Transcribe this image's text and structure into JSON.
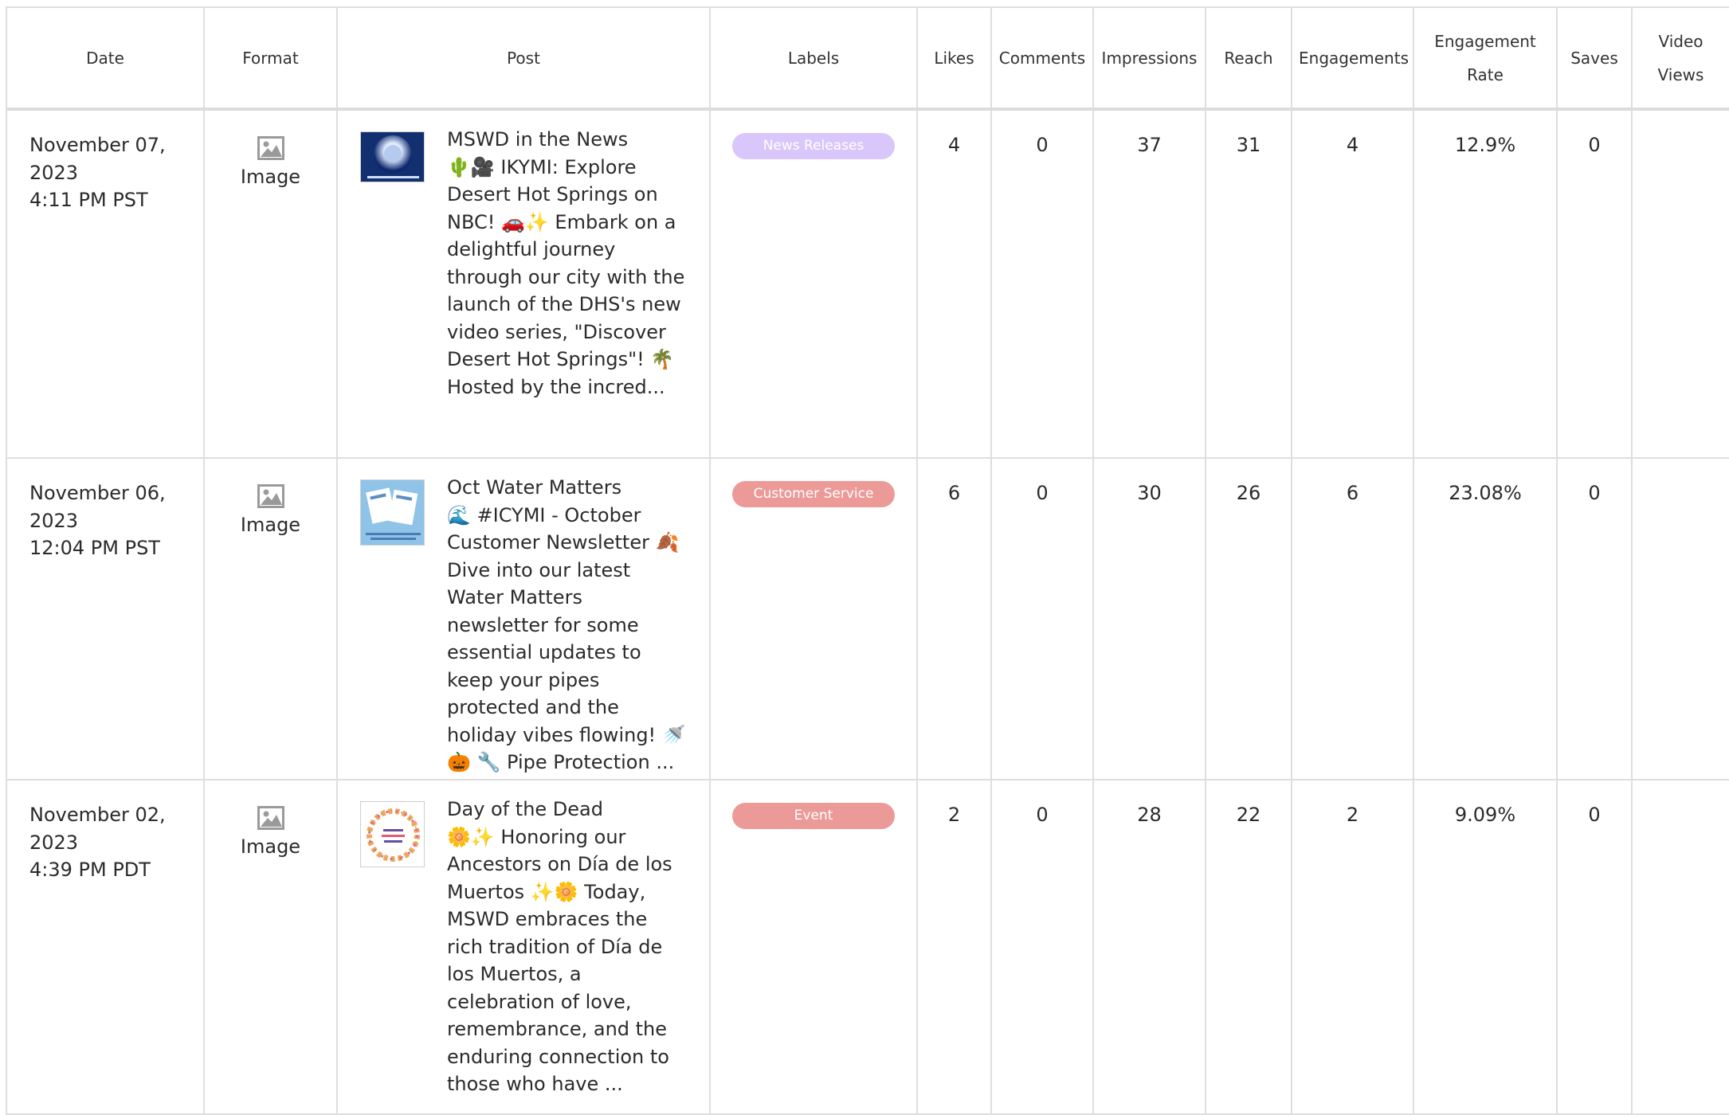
{
  "table": {
    "headers": {
      "date": "Date",
      "format": "Format",
      "post": "Post",
      "labels": "Labels",
      "likes": "Likes",
      "comments": "Comments",
      "impressions": "Impressions",
      "reach": "Reach",
      "engagements": "Engagements",
      "engagement_rate_1": "Engagement",
      "engagement_rate_2": "Rate",
      "saves": "Saves",
      "video_views_1": "Video",
      "video_views_2": "Views"
    },
    "rows": [
      {
        "date_line1": "November 07,",
        "date_line2": "2023",
        "date_line3": "4:11 PM PST",
        "format": "Image",
        "format_icon": "image-icon",
        "post_title": "MSWD in the News",
        "post_body": "🌵🎥 IKYMI: Explore Desert Hot Springs on NBC! 🚗✨ Embark on a delightful journey through our city with the launch of the DHS's new video series, \"Discover Desert Hot Springs\"! 🌴 Hosted by the incred...",
        "label": "News Releases",
        "label_color": "#d9c7fb",
        "likes": "4",
        "comments": "0",
        "impressions": "37",
        "reach": "31",
        "engagements": "4",
        "engagement_rate": "12.9%",
        "saves": "0",
        "video_views": ""
      },
      {
        "date_line1": "November 06,",
        "date_line2": "2023",
        "date_line3": "12:04 PM PST",
        "format": "Image",
        "format_icon": "image-icon",
        "post_title": "Oct Water Matters",
        "post_body": "🌊 #ICYMI - October Customer Newsletter 🍂 Dive into our latest Water Matters newsletter for some essential updates to keep your pipes protected and the holiday vibes flowing! 🚿🎃 🔧 Pipe Protection ...",
        "label": "Customer Service",
        "label_color": "#ec9a98",
        "likes": "6",
        "comments": "0",
        "impressions": "30",
        "reach": "26",
        "engagements": "6",
        "engagement_rate": "23.08%",
        "saves": "0",
        "video_views": ""
      },
      {
        "date_line1": "November 02,",
        "date_line2": "2023",
        "date_line3": "4:39 PM PDT",
        "format": "Image",
        "format_icon": "image-icon",
        "post_title": "Day of the Dead",
        "post_body": "🌼✨ Honoring our Ancestors on Día de los Muertos ✨🌼 Today, MSWD embraces the rich tradition of Día de los Muertos, a celebration of love, remembrance, and the enduring connection to those who have ...",
        "label": "Event",
        "label_color": "#ec9a98",
        "likes": "2",
        "comments": "0",
        "impressions": "28",
        "reach": "22",
        "engagements": "2",
        "engagement_rate": "9.09%",
        "saves": "0",
        "video_views": ""
      }
    ]
  }
}
